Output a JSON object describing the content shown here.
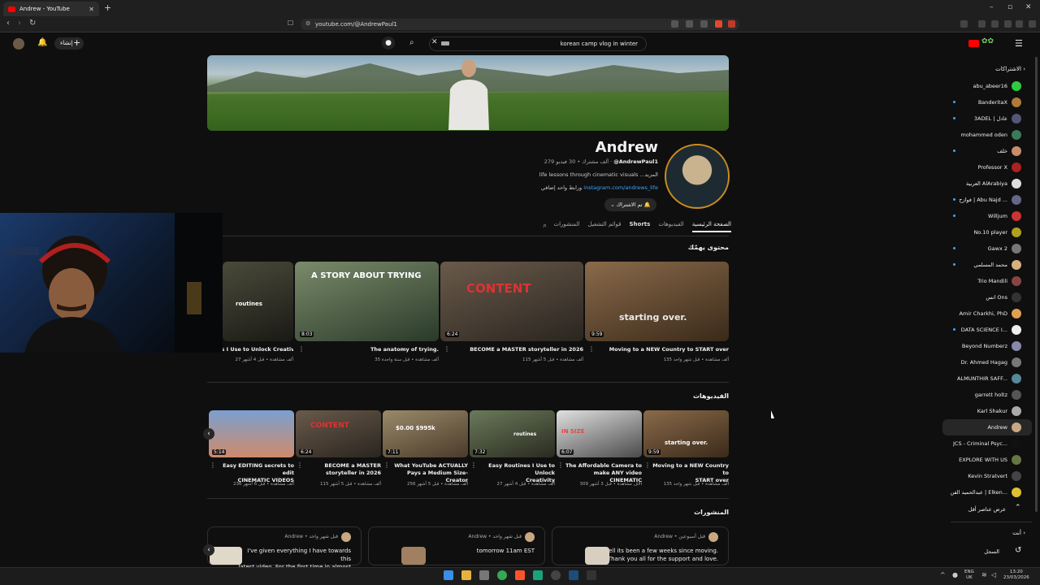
{
  "browser": {
    "tab_title": "Andrew - YouTube",
    "url": "youtube.com/@AndrewPaul1"
  },
  "header": {
    "search_query": "korean camp vlog in winter",
    "create_label": "إنشاء"
  },
  "channel": {
    "name": "Andrew",
    "handle": "@AndrewPaul1",
    "stats": "279 ألف مشترك • 30 فيديو",
    "description": "life lessons through cinematic visuals ...المزيد",
    "link_url": "instagram.com/andrews_life",
    "link_suffix": "ورابط واحد إضافي",
    "subscribed_label": "تم الاشتراك"
  },
  "tabs": [
    {
      "label": "الصفحة الرئيسية"
    },
    {
      "label": "الفيديوهات"
    },
    {
      "label": "Shorts"
    },
    {
      "label": "قوائم التشغيل"
    },
    {
      "label": "المنشورات"
    }
  ],
  "featured": {
    "title": "محتوى يهمّك",
    "videos": [
      {
        "title": "Moving to a NEW Country to START over",
        "meta": "135 ألف مشاهدة • قبل شهر واحد",
        "duration": "9:59",
        "overlay": "starting over."
      },
      {
        "title": "BECOME a MASTER storyteller in 2026",
        "meta": "115 ألف مشاهدة • قبل 5 أشهر",
        "duration": "6:24",
        "overlay": "CONTENT"
      },
      {
        "title": "The anatomy of trying.",
        "meta": "35 ألف مشاهدة • قبل سنة واحدة",
        "duration": "8:03",
        "overlay": "A STORY ABOUT TRYING"
      },
      {
        "title": "...ts I Use to Unlock Creativity",
        "meta": "27 ألف مشاهدة • قبل 4 أشهر",
        "duration": "",
        "overlay": "routines"
      }
    ]
  },
  "videos_section": {
    "title": "الفيديوهات",
    "videos": [
      {
        "title1": "Moving to a NEW Country to",
        "title2": "START over",
        "meta": "135 ألف مشاهدة • قبل شهر واحد",
        "duration": "9:59",
        "overlay": "starting over."
      },
      {
        "title1": "The Affordable Camera to",
        "title2": "make ANY video CINEMATIC",
        "meta": "309 آلاف مشاهدة • قبل 3 أشهر",
        "duration": "6:07",
        "overlay": "IN SIZE"
      },
      {
        "title1": "Easy Routines I Use to Unlock",
        "title2": "Creativity",
        "meta": "27 ألف مشاهدة • قبل 4 أشهر",
        "duration": "7:32",
        "overlay": "routines"
      },
      {
        "title1": "What YouTube ACTUALLY",
        "title2": "Pays a Medium Size-Creator",
        "meta": "256 ألف مشاهدة • قبل 5 أشهر",
        "duration": "7:11",
        "overlay": "$0.00  $995k"
      },
      {
        "title1": "BECOME a MASTER",
        "title2": "storyteller in 2026",
        "meta": "115 ألف مشاهدة • قبل 5 أشهر",
        "duration": "6:24",
        "overlay": "CONTENT"
      },
      {
        "title1": "Easy EDITING secrets to edit",
        "title2": "CINEMATIC VIDEOS",
        "meta": "236 ألف مشاهدة • قبل 6 أشهر",
        "duration": "5:14",
        "overlay": ""
      }
    ]
  },
  "posts_section": {
    "title": "المنشورات",
    "posts": [
      {
        "author": "Andrew",
        "time": "قبل أسبوعين",
        "text1": "well its been a few weeks since moving.",
        "text2": "Thank you all for the support and love."
      },
      {
        "author": "Andrew",
        "time": "قبل شهر واحد",
        "text1": "tomorrow 11am EST",
        "text2": ""
      },
      {
        "author": "Andrew",
        "time": "قبل شهر واحد",
        "text1": "I've given everything I have towards this",
        "text2": "latest video. For the first time in almost a"
      }
    ]
  },
  "sidebar": {
    "subscriptions_label": "الاشتراكات",
    "subscriptions": [
      {
        "name": "abu_abeer16",
        "color": "#2ecc40",
        "dot": false
      },
      {
        "name": "BanderitaX",
        "color": "#b07a3a",
        "dot": true
      },
      {
        "name": "3ADEL | عادل",
        "color": "#555577",
        "dot": true
      },
      {
        "name": "mohammed oden",
        "color": "#3a7a5a",
        "dot": false
      },
      {
        "name": "خلف",
        "color": "#c98c6a",
        "dot": true
      },
      {
        "name": "Professor X",
        "color": "#aa2222",
        "dot": false
      },
      {
        "name": "العربية AlArabiya",
        "color": "#dddddd",
        "dot": false
      },
      {
        "name": "فوازح | Abu Najd ...",
        "color": "#666688",
        "dot": true
      },
      {
        "name": "Willjum",
        "color": "#cc3333",
        "dot": true
      },
      {
        "name": "No.10 player",
        "color": "#b0a020",
        "dot": false
      },
      {
        "name": "Gawx 2",
        "color": "#777777",
        "dot": true
      },
      {
        "name": "محمد المسلمي",
        "color": "#d8b080",
        "dot": true
      },
      {
        "name": "Trio Mandili",
        "color": "#884444",
        "dot": false
      },
      {
        "name": "انس Ons",
        "color": "#333333",
        "dot": false
      },
      {
        "name": "Amir Charkhi, PhD",
        "color": "#e0a050",
        "dot": false
      },
      {
        "name": "DATA SCIENCE I...",
        "color": "#eeeeee",
        "dot": true
      },
      {
        "name": "Beyond Numberz",
        "color": "#8888aa",
        "dot": false
      },
      {
        "name": "Dr. Ahmed Hagag",
        "color": "#777777",
        "dot": false
      },
      {
        "name": "ALMUNTHIR SAFF...",
        "color": "#558899",
        "dot": false
      },
      {
        "name": "garrett holtz",
        "color": "#555555",
        "dot": false
      },
      {
        "name": "Karl Shakur",
        "color": "#aaaaaa",
        "dot": false
      },
      {
        "name": "Andrew",
        "color": "#c8a882",
        "dot": false
      },
      {
        "name": "JCS - Criminal Psyc...",
        "color": "#111111",
        "dot": false
      },
      {
        "name": "EXPLORE WITH US",
        "color": "#667744",
        "dot": false
      },
      {
        "name": "Kevin Stratvert",
        "color": "#444444",
        "dot": false
      },
      {
        "name": "عبدالحميد الفن | Elken...",
        "color": "#e0c030",
        "dot": false
      }
    ],
    "show_fewer": "عرض عناصر أقل",
    "you_label": "أنت",
    "history_label": "السجل"
  },
  "taskbar": {
    "lang1": "ENG",
    "lang2": "UK",
    "time": "13:20",
    "date": "23/03/2026"
  }
}
